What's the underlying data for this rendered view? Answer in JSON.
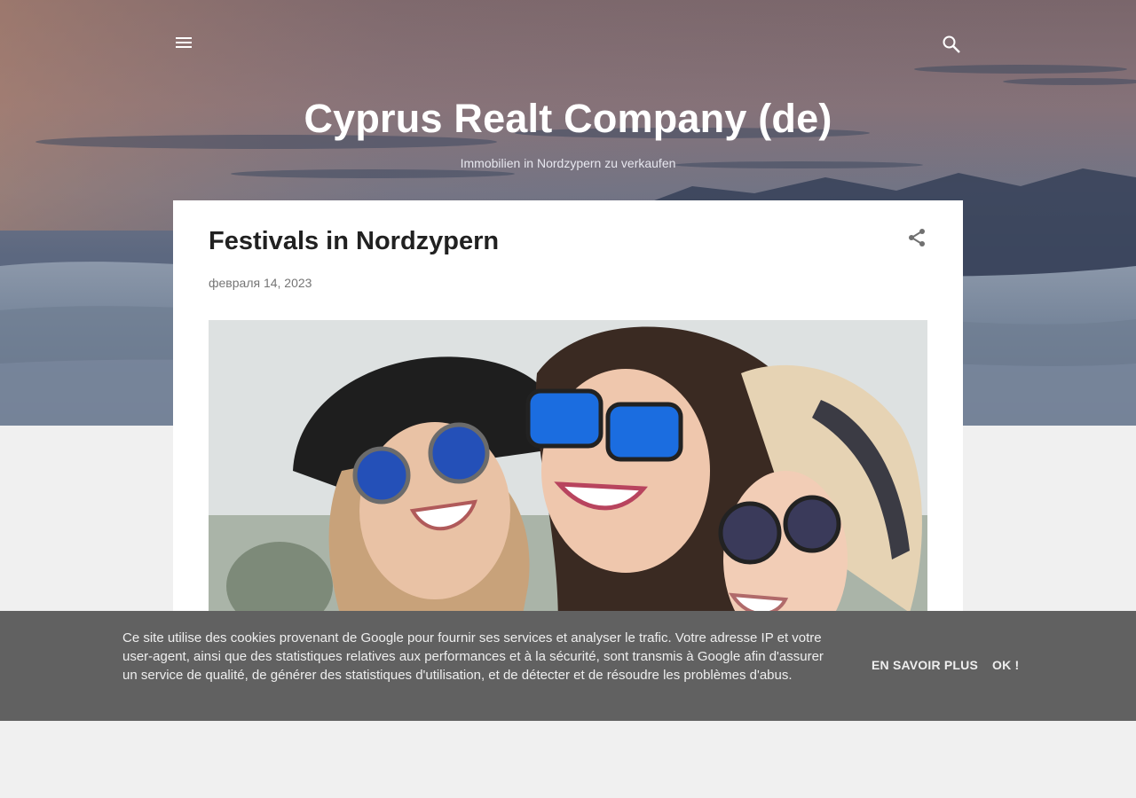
{
  "header": {
    "menu_icon": "hamburger-menu-icon",
    "search_icon": "search-icon"
  },
  "blog": {
    "title": "Cyprus Realt Company (de)",
    "description": "Immobilien in Nordzypern zu verkaufen"
  },
  "post": {
    "title": "Festivals in Nordzypern",
    "date": "февраля 14, 2023",
    "share_icon": "share-icon"
  },
  "cookie_notice": {
    "text": "Ce site utilise des cookies provenant de Google pour fournir ses services et analyser le trafic. Votre adresse IP et votre user-agent, ainsi que des statistiques relatives aux performances et à la sécurité, sont transmis à Google afin d'assurer un service de qualité, de générer des statistiques d'utilisation, et de détecter et de résoudre les problèmes d'abus.",
    "learn_more_label": "EN SAVOIR PLUS",
    "ok_label": "OK !"
  },
  "colors": {
    "card_bg": "#ffffff",
    "page_bg": "#f0f0f0",
    "cookie_bg": "#616161",
    "title_text": "#212121",
    "date_text": "#757575"
  }
}
